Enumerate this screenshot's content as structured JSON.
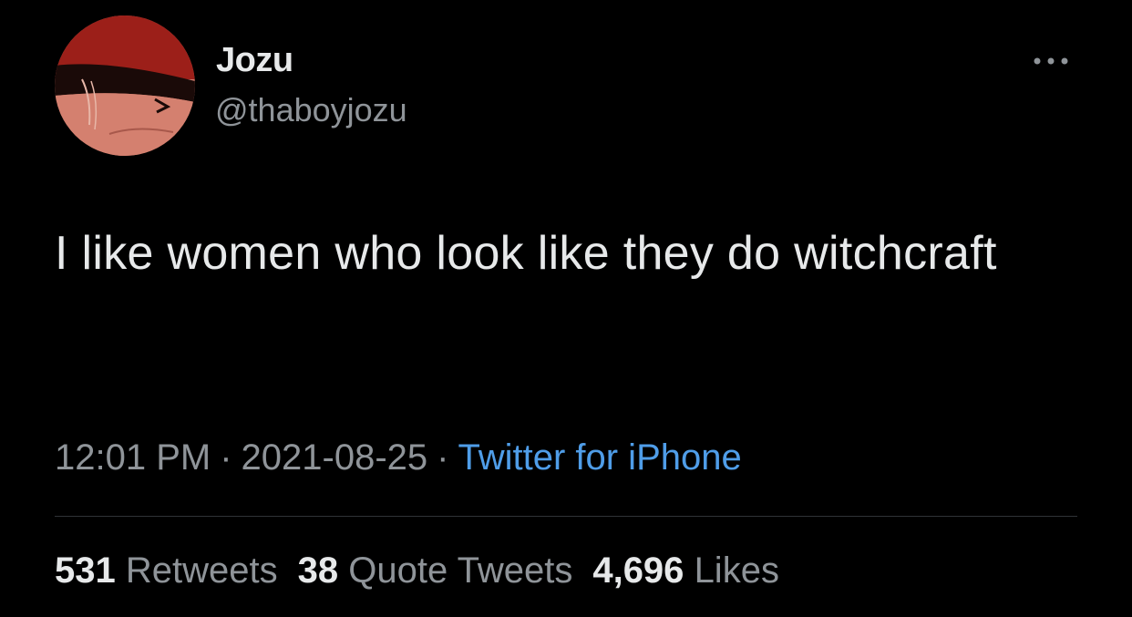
{
  "author": {
    "display_name": "Jozu",
    "handle": "@thaboyjozu"
  },
  "tweet": {
    "text": "I like women who look like they do witchcraft",
    "time": "12:01 PM",
    "separator": "·",
    "date": "2021-08-25",
    "source": "Twitter for iPhone"
  },
  "stats": {
    "retweets_count": "531",
    "retweets_label": "Retweets",
    "quotes_count": "38",
    "quotes_label": "Quote Tweets",
    "likes_count": "4,696",
    "likes_label": "Likes"
  },
  "icons": {
    "more": "more-options-icon",
    "avatar": "avatar-image"
  },
  "colors": {
    "background": "#000000",
    "text_primary": "#e7e9ea",
    "text_secondary": "#8f9499",
    "link": "#4f9de8",
    "divider": "#2f3336"
  }
}
